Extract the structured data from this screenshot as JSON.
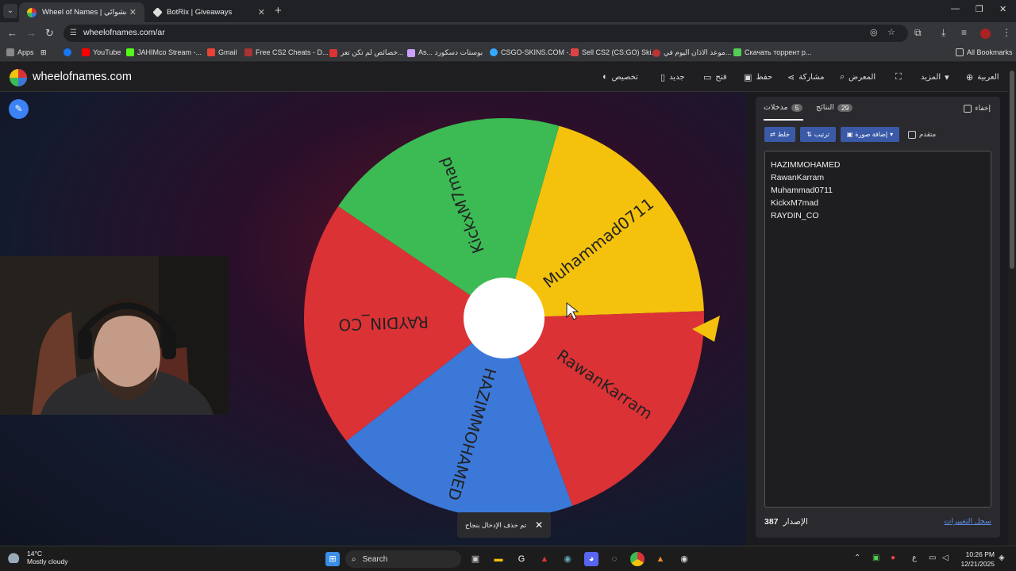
{
  "browser": {
    "tabs": [
      {
        "title": "Wheel of Names | العشوائي",
        "active": true
      },
      {
        "title": "BotRix | Giveaways",
        "active": false
      }
    ],
    "url": "wheelofnames.com/ar",
    "bookmarks": [
      {
        "label": "Apps",
        "color": "#aaaaaa"
      },
      {
        "label": "YouTube",
        "color": "#ff0000"
      },
      {
        "label": "JAHIMco Stream -...",
        "color": "#53fc18"
      },
      {
        "label": "Gmail",
        "color": "#ea4335"
      },
      {
        "label": "Free CS2 Cheats - D...",
        "color": "#a33"
      },
      {
        "label": "خصائص لم تكن تعر...",
        "color": "#d33"
      },
      {
        "label": "As... بوستات دسكورد",
        "color": "#c9a0ff"
      },
      {
        "label": "CSGO-SKINS.COM -...",
        "color": "#33aaff"
      },
      {
        "label": "Sell CS2 (CS:GO) Ski...",
        "color": "#d44"
      },
      {
        "label": "موعد الاذان اليوم في...",
        "color": "#b33"
      },
      {
        "label": "Скачать торрент р...",
        "color": "#5c5"
      }
    ],
    "all_bookmarks": "All Bookmarks"
  },
  "site": {
    "brand": "wheelofnames.com",
    "nav": {
      "customize": "تخصيص",
      "new": "جديد",
      "open": "فتح",
      "save": "حفظ",
      "share": "مشاركة",
      "gallery": "المعرض",
      "more": "المزيد",
      "language": "العربية"
    }
  },
  "wheel": {
    "segments": [
      {
        "label": "Muhammad0711",
        "color": "#f4c20d"
      },
      {
        "label": "RawanKarram",
        "color": "#db3236"
      },
      {
        "label": "HAZIMMOHAMED",
        "color": "#3c78d8"
      },
      {
        "label": "RAYDIN_CO",
        "color": "#db3236"
      },
      {
        "label": "KickxM7mad",
        "color": "#3cba54"
      }
    ],
    "pointer_color": "#f4c20d"
  },
  "toast": {
    "text": "تم حذف الإدخال بنجاح",
    "close": "✕"
  },
  "panel": {
    "tab_entries": {
      "label": "مدخلات",
      "count": "5"
    },
    "tab_results": {
      "label": "النتائج",
      "count": "29"
    },
    "hide": "إخفاء",
    "shuffle": "خلط",
    "sort": "ترتيب",
    "add_image": "إضافة صورة",
    "advanced": "متقدم",
    "entries": [
      "HAZIMMOHAMED",
      "RawanKarram",
      "Muhammad0711",
      "KickxM7mad",
      "RAYDIN_CO"
    ],
    "version_label": "الإصدار",
    "version": "387",
    "changelog": "سجل التغييرات"
  },
  "taskbar": {
    "temp": "14°C",
    "weather": "Mostly cloudy",
    "search": "Search",
    "time": "10:26 PM",
    "date": "12/21/2025",
    "lang": "ع"
  }
}
